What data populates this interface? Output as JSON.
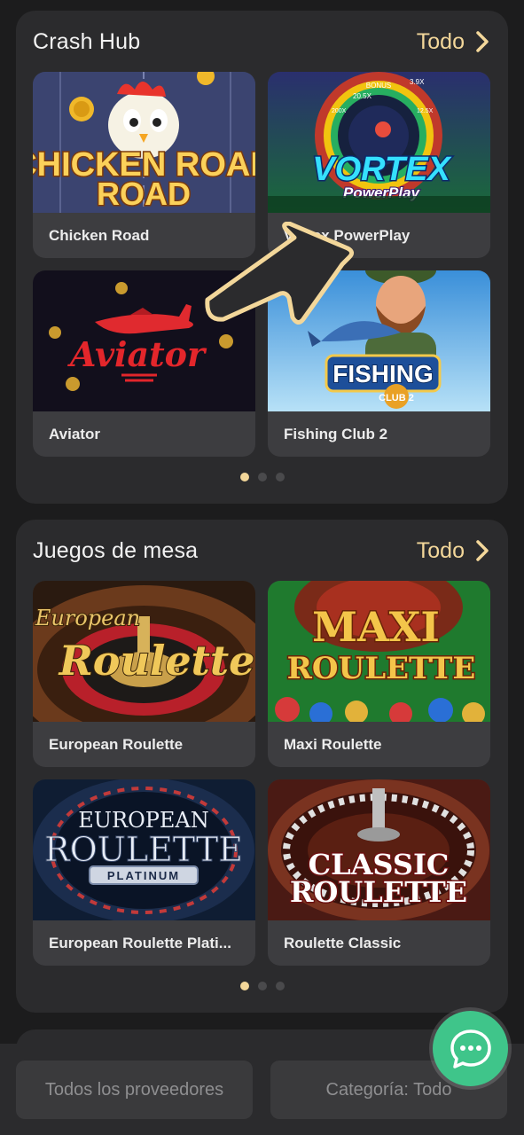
{
  "sections": [
    {
      "title": "Crash Hub",
      "all_label": "Todo",
      "games": [
        {
          "name": "Chicken Road",
          "thumb_title": "CHICKEN ROAD"
        },
        {
          "name": "Vortex PowerPlay",
          "thumb_title": "VORTEX",
          "thumb_subtitle": "PowerPlay",
          "wheel_labels": [
            "BONUS",
            "3.9X",
            "200X",
            "20.5X",
            "12.5X"
          ]
        },
        {
          "name": "Aviator",
          "thumb_title": "Aviator"
        },
        {
          "name": "Fishing Club 2",
          "thumb_title": "FISHING",
          "thumb_subtitle": "CLUB 2"
        }
      ],
      "pagination": {
        "count": 3,
        "active": 0
      }
    },
    {
      "title": "Juegos de mesa",
      "all_label": "Todo",
      "games": [
        {
          "name": "European Roulette",
          "thumb_title": "European",
          "thumb_subtitle": "Roulette"
        },
        {
          "name": "Maxi Roulette",
          "thumb_title": "MAXI",
          "thumb_subtitle": "ROULETTE"
        },
        {
          "name": "European Roulette Plati...",
          "thumb_title": "EUROPEAN",
          "thumb_subtitle": "ROULETTE",
          "thumb_badge": "PLATINUM"
        },
        {
          "name": "Roulette Classic",
          "thumb_title": "CLASSIC",
          "thumb_subtitle": "ROULETTE"
        }
      ],
      "pagination": {
        "count": 3,
        "active": 0
      }
    }
  ],
  "filters": {
    "providers_label": "Todos los proveedores",
    "category_label": "Categoría: Todo"
  },
  "icons": {
    "chevron": "chevron-right-icon",
    "chat": "chat-bubble-icon",
    "pointer": "pointer-arrow-icon"
  },
  "colors": {
    "accent": "#f3d79a",
    "chat": "#3fc58a",
    "card": "#3d3d40",
    "section": "#2b2b2d"
  }
}
